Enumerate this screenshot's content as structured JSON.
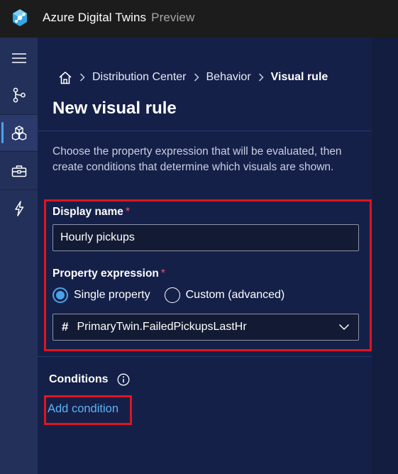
{
  "header": {
    "title": "Azure Digital Twins",
    "badge": "Preview",
    "logo_icon": "digital-twins-logo-icon"
  },
  "leftnav": {
    "items": [
      {
        "icon": "hamburger-menu-icon",
        "active": false
      },
      {
        "icon": "graph-branch-icon",
        "active": false
      },
      {
        "icon": "3d-cubes-icon",
        "active": true
      },
      {
        "icon": "toolbox-icon",
        "active": false
      },
      {
        "icon": "lightning-icon",
        "active": false
      }
    ]
  },
  "breadcrumb": {
    "home_icon": "home-icon",
    "items": [
      "Distribution Center",
      "Behavior",
      "Visual rule"
    ]
  },
  "page": {
    "title": "New visual rule",
    "description": "Choose the property expression that will be evaluated, then create conditions that determine which visuals are shown."
  },
  "form": {
    "display_name_label": "Display name",
    "required_marker": "*",
    "display_name_value": "Hourly pickups",
    "property_expression_label": "Property expression",
    "radio_single": "Single property",
    "radio_custom": "Custom (advanced)",
    "selected_mode": "single",
    "dropdown_prefix": "#",
    "dropdown_value": "PrimaryTwin.FailedPickupsLastHr"
  },
  "conditions": {
    "label": "Conditions",
    "add_label": "Add condition"
  },
  "colors": {
    "accent": "#4aa3e8",
    "highlight": "#e0141e",
    "panel": "#152049",
    "nav": "#233059"
  }
}
